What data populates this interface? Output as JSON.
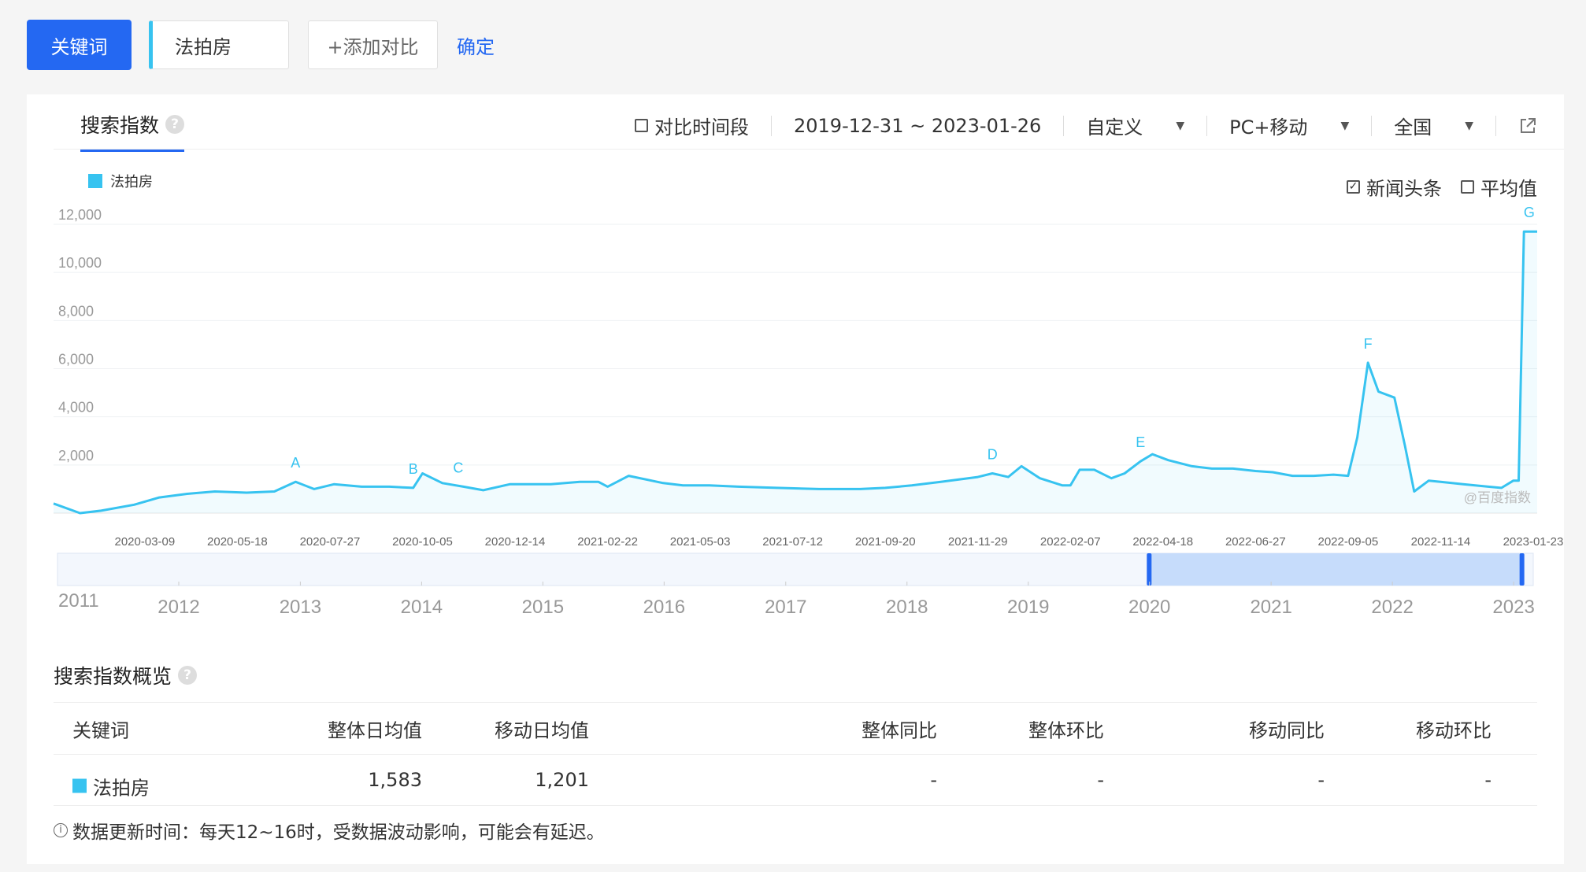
{
  "toolbar": {
    "keyword_button": "关键词",
    "keyword_value": "法拍房",
    "add_compare": "+添加对比",
    "confirm": "确定"
  },
  "panel": {
    "title": "搜索指数",
    "compare_period": "对比时间段",
    "date_range": "2019-12-31 ~ 2023-01-26",
    "range_mode": "自定义",
    "device": "PC+移动",
    "region": "全国",
    "news_headlines": "新闻头条",
    "average": "平均值",
    "watermark": "@百度指数"
  },
  "colors": {
    "primary": "#2468f2",
    "series": "#37c3f0",
    "brush": "#c6dcfb"
  },
  "chart_data": {
    "type": "area",
    "legend": [
      "法拍房"
    ],
    "y_ticks": [
      "12,000",
      "10,000",
      "8,000",
      "6,000",
      "4,000",
      "2,000"
    ],
    "ylim": [
      0,
      12000
    ],
    "x_ticks": [
      "2020-03-09",
      "2020-05-18",
      "2020-07-27",
      "2020-10-05",
      "2020-12-14",
      "2021-02-22",
      "2021-05-03",
      "2021-07-12",
      "2021-09-20",
      "2021-11-29",
      "2022-02-07",
      "2022-04-18",
      "2022-06-27",
      "2022-09-05",
      "2022-11-14",
      "2023-01-23"
    ],
    "series": [
      {
        "name": "法拍房",
        "x": [
          "2019-12-31",
          "2020-01-20",
          "2020-02-05",
          "2020-03-01",
          "2020-03-20",
          "2020-04-10",
          "2020-05-01",
          "2020-05-25",
          "2020-06-15",
          "2020-07-01",
          "2020-07-15",
          "2020-07-30",
          "2020-08-20",
          "2020-09-10",
          "2020-09-28",
          "2020-10-05",
          "2020-10-20",
          "2020-11-05",
          "2020-11-20",
          "2020-12-10",
          "2021-01-10",
          "2021-02-01",
          "2021-02-15",
          "2021-02-22",
          "2021-03-10",
          "2021-04-05",
          "2021-04-20",
          "2021-05-10",
          "2021-06-01",
          "2021-06-30",
          "2021-08-01",
          "2021-09-01",
          "2021-09-20",
          "2021-10-10",
          "2021-11-01",
          "2021-11-29",
          "2021-12-10",
          "2021-12-22",
          "2022-01-01",
          "2022-01-15",
          "2022-02-01",
          "2022-02-07",
          "2022-02-14",
          "2022-02-25",
          "2022-03-10",
          "2022-03-20",
          "2022-04-01",
          "2022-04-10",
          "2022-04-22",
          "2022-05-10",
          "2022-05-25",
          "2022-06-10",
          "2022-06-27",
          "2022-07-10",
          "2022-07-25",
          "2022-08-10",
          "2022-08-25",
          "2022-09-05",
          "2022-09-12",
          "2022-09-20",
          "2022-09-28",
          "2022-10-10",
          "2022-10-18",
          "2022-10-25",
          "2022-11-05",
          "2022-11-14",
          "2022-12-01",
          "2022-12-20",
          "2022-12-30",
          "2023-01-08",
          "2023-01-12",
          "2023-01-16",
          "2023-01-26"
        ],
        "values": [
          400,
          0,
          100,
          350,
          650,
          800,
          900,
          850,
          900,
          1300,
          1000,
          1200,
          1100,
          1100,
          1050,
          1650,
          1250,
          1100,
          950,
          1200,
          1200,
          1300,
          1300,
          1100,
          1550,
          1250,
          1150,
          1150,
          1100,
          1050,
          1000,
          1000,
          1050,
          1150,
          1300,
          1500,
          1650,
          1500,
          1950,
          1450,
          1150,
          1150,
          1800,
          1800,
          1450,
          1650,
          2150,
          2450,
          2200,
          1950,
          1850,
          1850,
          1750,
          1700,
          1550,
          1550,
          1600,
          1550,
          3150,
          6250,
          5050,
          4800,
          2800,
          900,
          1350,
          1300,
          1200,
          1100,
          1050,
          1350,
          1350,
          11700,
          11700
        ]
      }
    ],
    "annotations": [
      {
        "label": "A",
        "x": "2020-07-01"
      },
      {
        "label": "B",
        "x": "2020-09-28"
      },
      {
        "label": "C",
        "x": "2020-11-01"
      },
      {
        "label": "D",
        "x": "2021-12-10"
      },
      {
        "label": "E",
        "x": "2022-04-01"
      },
      {
        "label": "F",
        "x": "2022-09-20"
      },
      {
        "label": "G",
        "x": "2023-01-20"
      }
    ],
    "brush_years": [
      "2011",
      "2012",
      "2013",
      "2014",
      "2015",
      "2016",
      "2017",
      "2018",
      "2019",
      "2020",
      "2021",
      "2022",
      "2023"
    ],
    "brush_range": [
      "2019-12-31",
      "2023-01-26"
    ],
    "grid": true
  },
  "summary": {
    "title": "搜索指数概览",
    "headers": [
      "关键词",
      "整体日均值",
      "移动日均值",
      "整体同比",
      "整体环比",
      "移动同比",
      "移动环比"
    ],
    "row": [
      "法拍房",
      "1,583",
      "1,201",
      "-",
      "-",
      "-",
      "-"
    ],
    "note": "数据更新时间：每天12~16时，受数据波动影响，可能会有延迟。"
  }
}
